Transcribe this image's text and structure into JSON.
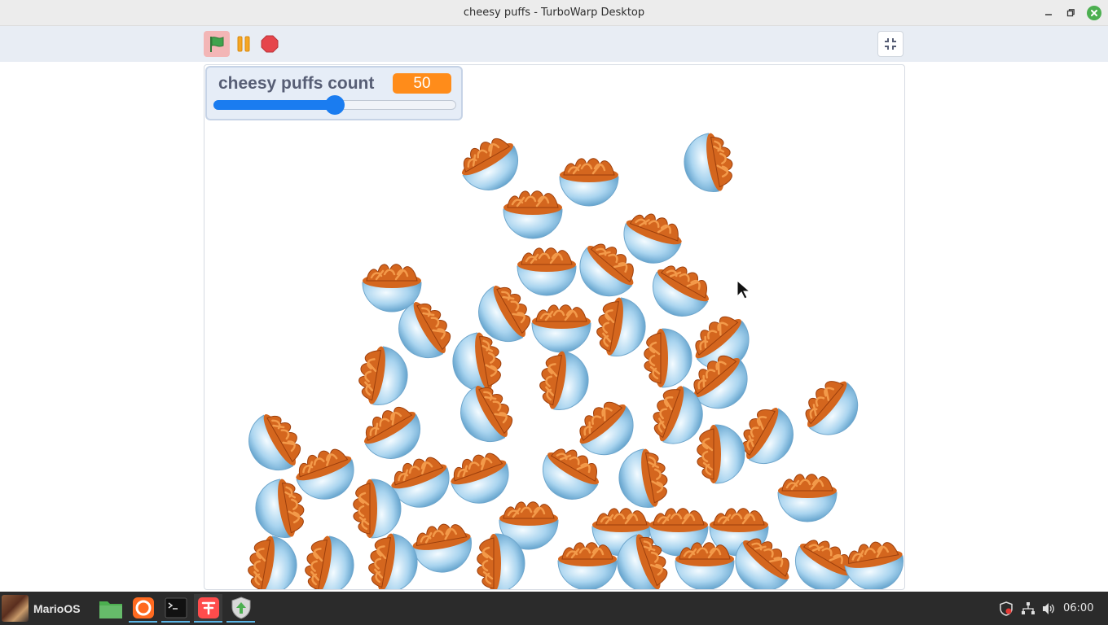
{
  "window": {
    "title": "cheesy puffs - TurboWarp Desktop",
    "minimize_icon": "minimize-icon",
    "maximize_icon": "maximize-icon",
    "close_icon": "close-icon"
  },
  "toolbar": {
    "green_flag_icon": "green-flag-icon",
    "pause_icon": "pause-icon",
    "stop_icon": "stop-icon",
    "exit_fullscreen_icon": "exit-fullscreen-icon"
  },
  "monitor": {
    "label": "cheesy puffs count",
    "value": "50",
    "slider_fraction": 0.5
  },
  "stage": {
    "sprite": "cheesy-puffs-bowl",
    "sprite_count": 50
  },
  "taskbar": {
    "start_label": "MarioOS",
    "apps": [
      {
        "name": "files",
        "icon": "folder-icon"
      },
      {
        "name": "firefox",
        "icon": "firefox-icon"
      },
      {
        "name": "terminal",
        "icon": "terminal-icon"
      },
      {
        "name": "turbowarp",
        "icon": "turbowarp-icon"
      },
      {
        "name": "update-manager",
        "icon": "shield-update-icon"
      }
    ],
    "tray": [
      "shield-icon",
      "network-icon",
      "volume-icon"
    ],
    "clock": "06:00"
  },
  "colors": {
    "accent": "#1a7cf0",
    "value_badge": "#ff8c1a",
    "flag_active_bg": "#f3b6b6",
    "stop": "#e6454b",
    "pause": "#f5a623",
    "flag": "#3fa34d",
    "bowl": "#a9d4ef",
    "puffs": "#d4661e",
    "taskbar": "#2b2b2b"
  }
}
